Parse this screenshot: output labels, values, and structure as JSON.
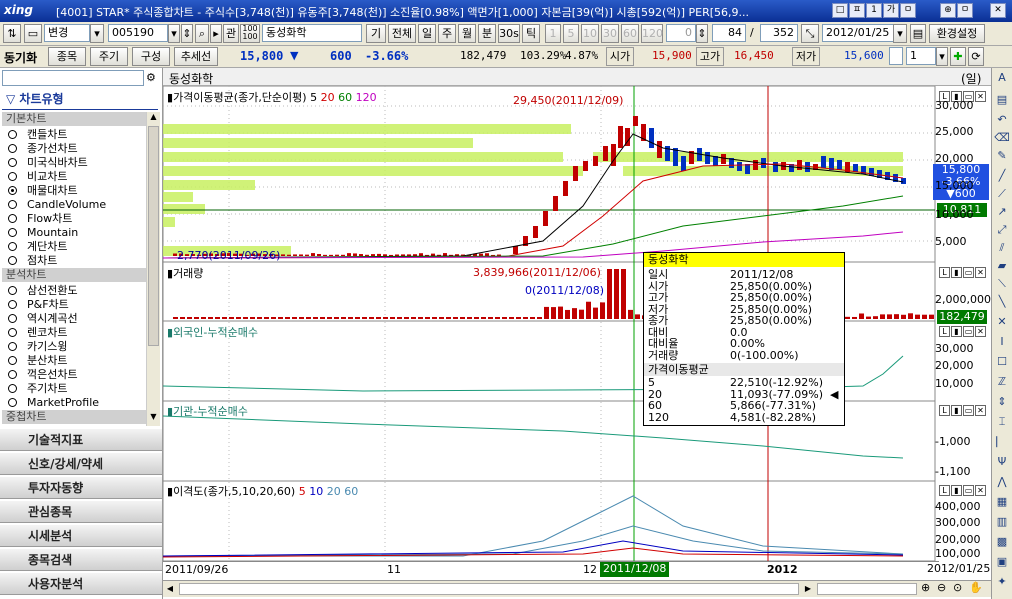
{
  "window": {
    "logo": "xing",
    "title": "[4001] STAR* 주식종합차트 - 주식수[3,748(천)] 유동주[3,748(천)] 소진율[0.98%] 액면가[1,000] 자본금[39(억)] 시총[592(억)] PER[56,9...",
    "buttons": [
      "□",
      "ㅍ",
      "1",
      "가",
      "ㅁ",
      "⊕",
      "ㅁ",
      "✕"
    ]
  },
  "toolbar1": {
    "mode": "변경",
    "code": "005190",
    "kwan": "관",
    "stock_name": "동성화학",
    "period_buttons": [
      "기",
      "전체",
      "일",
      "주",
      "월",
      "분",
      "30s",
      "틱"
    ],
    "num_buttons": [
      "1",
      "5",
      "10",
      "30",
      "60",
      "120"
    ],
    "interval": "0",
    "count": "84",
    "slash": "/",
    "total": "352",
    "date": "2012/01/25",
    "env_button": "환경설정"
  },
  "toolbar2": {
    "sync_label": "동기화",
    "buttons": [
      "종목",
      "주기",
      "구성",
      "추세선"
    ],
    "price": "15,800",
    "arrow": "▼",
    "change": "600",
    "change_pct": "-3.66%",
    "volume": "182,479",
    "ratio1": "103.29%",
    "ratio2": "4.87%",
    "open_label": "시가",
    "open": "15,900",
    "high_label": "고가",
    "high": "16,450",
    "low_label": "저가",
    "low": "15,600",
    "spin": "1"
  },
  "leftpanel": {
    "chart_type_header": "차트유형",
    "basic_header": "기본차트",
    "basic_items": [
      "캔들차트",
      "종가선차트",
      "미국식바차트",
      "비교차트",
      "매물대차트",
      "CandleVolume",
      "Flow차트",
      "Mountain",
      "계단차트",
      "점차트"
    ],
    "selected_item": "매물대차트",
    "analysis_header": "분석차트",
    "analysis_items": [
      "삼선전환도",
      "P&F차트",
      "역시계곡선",
      "렌코차트",
      "카기스윙",
      "분산차트",
      "꺽은선차트",
      "주기차트",
      "MarketProfile"
    ],
    "overlay_header": "중첩차트",
    "nav": [
      "기술적지표",
      "신호/강세/약세",
      "투자자동향",
      "관심종목",
      "시세분석",
      "종목검색",
      "사용자분석"
    ]
  },
  "chart": {
    "name": "동성화학",
    "period_unit": "(일)",
    "price_panel": {
      "title": "가격이동평균(종가,단순이평)",
      "params": [
        "5",
        "20",
        "60",
        "120"
      ],
      "param_colors": [
        "#000000",
        "#d00000",
        "#008000",
        "#c000c0"
      ],
      "axis_labels": [
        "30,000",
        "25,000",
        "20,000",
        "15,000",
        "10,000",
        "5,000"
      ],
      "max_annot": "29,450(2011/12/09)",
      "min_annot": "2,770(2011/09/26)",
      "cur_price": "15,800",
      "cur_chg": "-3.66%",
      "cur_diff": "▼600",
      "ma_marker": "10,811"
    },
    "volume_panel": {
      "title": "거래량",
      "axis_labels": [
        "2,000,000"
      ],
      "max_annot": "3,839,966(2011/12/06)",
      "zero_annot": "0(2011/12/08)",
      "cur_vol": "182,479"
    },
    "foreign_panel": {
      "title": "외국인-누적순매수",
      "axis_labels": [
        "30,000",
        "20,000",
        "10,000"
      ]
    },
    "inst_panel": {
      "title": "기관-누적순매수",
      "axis_labels": [
        "-1,000",
        "-1,100"
      ]
    },
    "disparity_panel": {
      "title": "이격도(종가,5,10,20,60)",
      "params": [
        "5",
        "10",
        "20",
        "60"
      ],
      "param_colors": [
        "#d00000",
        "#0000c0",
        "#4a8ab0",
        "#4a8ab0"
      ],
      "axis_labels": [
        "400,000",
        "300,000",
        "200,000",
        "100,000"
      ]
    },
    "xaxis": {
      "labels": [
        "2011/09/26",
        "11",
        "12",
        "2011/12/08",
        "2012",
        "2012/01/25"
      ]
    }
  },
  "tooltip": {
    "name": "동성화학",
    "rows": [
      {
        "k": "일시",
        "v": "2011/12/08"
      },
      {
        "k": "시가",
        "v": "25,850(0.00%)"
      },
      {
        "k": "고가",
        "v": "25,850(0.00%)"
      },
      {
        "k": "저가",
        "v": "25,850(0.00%)"
      },
      {
        "k": "종가",
        "v": "25,850(0.00%)"
      },
      {
        "k": "대비",
        "v": "0.0"
      },
      {
        "k": "대비율",
        "v": "0.00%"
      },
      {
        "k": "거래량",
        "v": "0(-100.00%)"
      }
    ],
    "ma_header": "가격이동평균",
    "ma_rows": [
      {
        "k": "5",
        "v": "22,510(-12.92%)"
      },
      {
        "k": "20",
        "v": "11,093(-77.09%)"
      },
      {
        "k": "60",
        "v": "5,866(-77.31%)"
      },
      {
        "k": "120",
        "v": "4,581(-82.28%)"
      }
    ]
  }
}
